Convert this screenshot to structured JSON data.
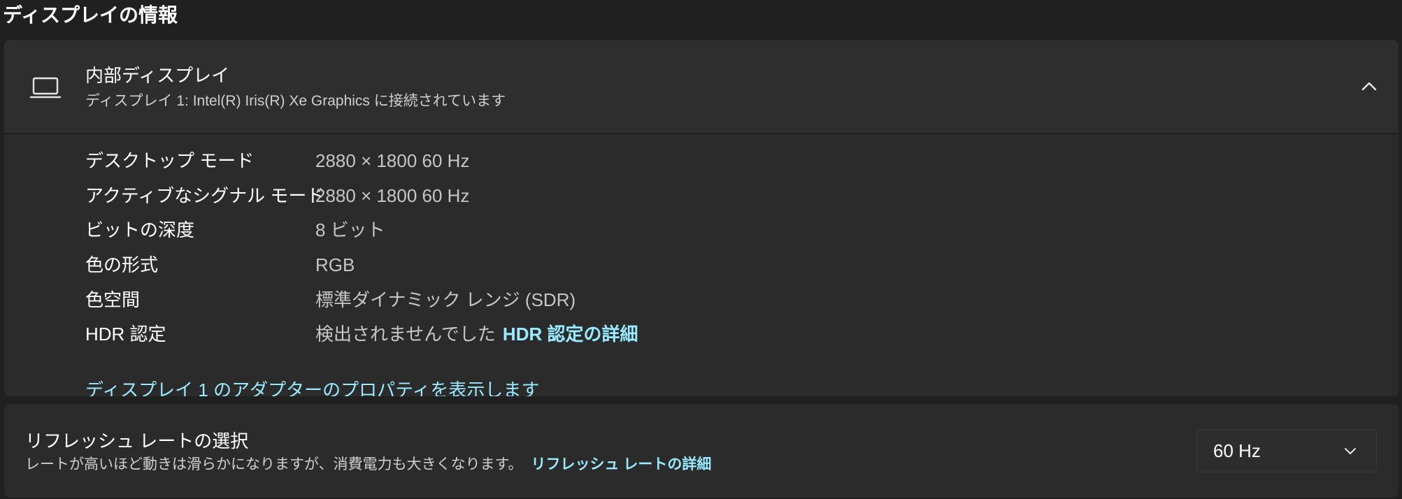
{
  "section": {
    "title": "ディスプレイの情報"
  },
  "display": {
    "icon": "laptop-icon",
    "title": "内部ディスプレイ",
    "subtitle": "ディスプレイ 1: Intel(R) Iris(R) Xe Graphics に接続されています",
    "collapse_icon": "chevron-up-icon",
    "properties": [
      {
        "label": "デスクトップ モード",
        "value": "2880 × 1800 60 Hz"
      },
      {
        "label": "アクティブなシグナル モード",
        "value": "2880 × 1800 60 Hz"
      },
      {
        "label": "ビットの深度",
        "value": "8 ビット"
      },
      {
        "label": "色の形式",
        "value": "RGB"
      },
      {
        "label": "色空間",
        "value": "標準ダイナミック レンジ (SDR)"
      },
      {
        "label": "HDR 認定",
        "value": "検出されませんでした",
        "link": "HDR 認定の詳細"
      }
    ],
    "adapter_link": "ディスプレイ 1 のアダプターのプロパティを表示します"
  },
  "refresh": {
    "title": "リフレッシュ レートの選択",
    "description": "レートが高いほど動きは滑らかになりますが、消費電力も大きくなります。",
    "link": "リフレッシュ レートの詳細",
    "selected": "60 Hz",
    "dropdown_icon": "chevron-down-icon"
  },
  "colors": {
    "background": "#202020",
    "card": "#2b2b2b",
    "link": "#99ebff",
    "secondary_text": "#c6c6c6"
  }
}
